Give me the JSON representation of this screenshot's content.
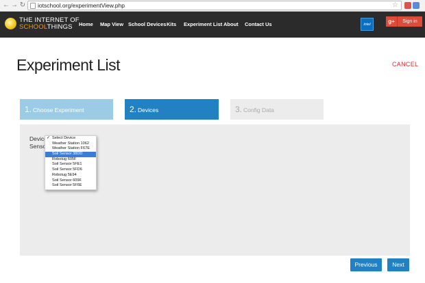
{
  "browser": {
    "url": "iotschool.org/experimentView.php"
  },
  "header": {
    "logo_line1": "THE INTERNET OF",
    "logo_line2_part1": "SCHOOL",
    "logo_line2_part2": "THINGS",
    "nav": [
      "Home",
      "Map View",
      "School Devices",
      "Kits",
      "Experiment List",
      "About",
      "Contact Us"
    ],
    "intel_label": "intel",
    "gplus_label": "g+",
    "signin_label": "Sign in"
  },
  "page": {
    "title": "Experiment List",
    "cancel_label": "CANCEL"
  },
  "steps": [
    {
      "num": "1.",
      "label": "Choose Experiment"
    },
    {
      "num": "2.",
      "label": "Devices"
    },
    {
      "num": "3.",
      "label": "Config Data"
    }
  ],
  "form": {
    "device_label": "Device",
    "sensor_label": "Sensor",
    "device_options": [
      "Select Device",
      "Weather Station 1062",
      "Weather Station F67E",
      "Soil Sensor 38DD",
      "Robotug 605F",
      "Soil Sensor 5FE1",
      "Soil Sensor 5FD6",
      "Robotug 5E94",
      "Soil Sensor 609F",
      "Soil Sensor 5F6E"
    ],
    "checked_option": "Select Device",
    "highlighted_option": "Soil Sensor 38DD"
  },
  "buttons": {
    "previous": "Previous",
    "next": "Next"
  },
  "colors": {
    "header_bg": "#2b2b2b",
    "step_active": "#2281c2",
    "step_done": "#9ccbe6",
    "cancel": "#d32f2f"
  }
}
